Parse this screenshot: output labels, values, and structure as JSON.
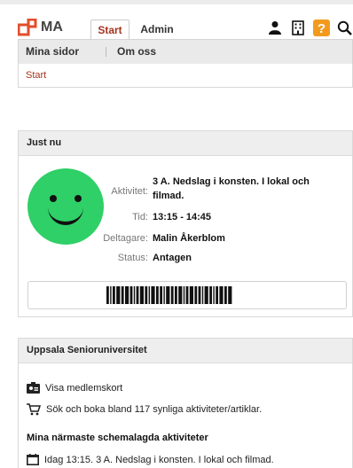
{
  "app": {
    "logo_text": "MA",
    "brand_color": "#e24d2a"
  },
  "tabs": [
    {
      "label": "Start",
      "active": true
    },
    {
      "label": "Admin",
      "active": false
    }
  ],
  "header_icons": [
    "person-icon",
    "building-icon",
    "help-icon",
    "search-icon"
  ],
  "nav": {
    "items": [
      "Mina sidor",
      "Om oss"
    ]
  },
  "breadcrumb": {
    "current": "Start"
  },
  "just_now": {
    "title": "Just nu",
    "status_color": "#2ed067",
    "fields": [
      {
        "label": "Aktivitet:",
        "value": "3 A. Nedslag i konsten. I lokal och filmad."
      },
      {
        "label": "Tid:",
        "value": "13:15 - 14:45"
      },
      {
        "label": "Deltagare:",
        "value": "Malin Åkerblom"
      },
      {
        "label": "Status:",
        "value": "Antagen"
      }
    ]
  },
  "org": {
    "title": "Uppsala Senioruniversitet",
    "membership_link": "Visa medlemskort",
    "search_link": "Sök och boka bland 117 synliga aktiviteter/artiklar.",
    "upcoming_title": "Mina närmaste schemalagda aktiviteter",
    "upcoming": [
      "Idag 13:15. 3 A. Nedslag i konsten. I lokal och filmad."
    ]
  }
}
